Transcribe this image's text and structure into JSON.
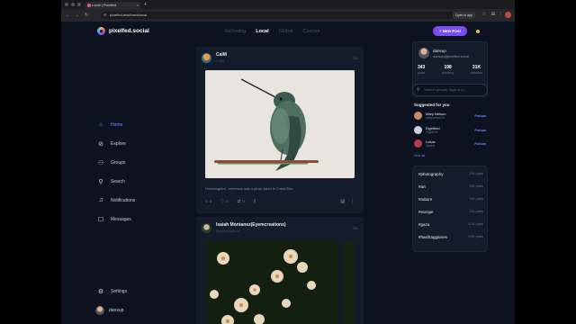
{
  "browser": {
    "tab_title": "Local | Pixelfed",
    "url": "pixelfed.test/i/web/local",
    "open_in_app": "Open in app"
  },
  "header": {
    "logo_text": "pixelfed.social",
    "nav": [
      "Following",
      "Local",
      "Global",
      "Custom"
    ],
    "new_post": "+ New Post"
  },
  "sidebar": {
    "items": [
      {
        "label": "Home",
        "icon": "home-icon"
      },
      {
        "label": "Explore",
        "icon": "compass-icon"
      },
      {
        "label": "Groups",
        "icon": "groups-icon"
      },
      {
        "label": "Search",
        "icon": "search-icon"
      },
      {
        "label": "Notifications",
        "icon": "bell-icon"
      },
      {
        "label": "Messages",
        "icon": "chat-icon"
      }
    ],
    "settings": "Settings",
    "user": "dansup"
  },
  "feed": {
    "posts": [
      {
        "name": "CalM",
        "handle": "CalM",
        "time": "18s",
        "caption": "Hummingbird - reference was a photo taken in Costa Rica",
        "likes": "0",
        "comments": "0",
        "shares": "0"
      },
      {
        "name": "Isaiah Montanez(Eyemcreations)",
        "handle": "Eyemcreations",
        "time": "35s"
      }
    ]
  },
  "profile": {
    "username": "dansup",
    "email": "dansup@pixelfed.social",
    "stats": [
      {
        "value": "343",
        "label": "posts"
      },
      {
        "value": "198",
        "label": "following"
      },
      {
        "value": "31K",
        "label": "followers"
      }
    ]
  },
  "search": {
    "placeholder": "Search people, tags or pl..."
  },
  "suggestions": {
    "title": "Suggested for you",
    "items": [
      {
        "name": "Mary Nelson",
        "handle": "marynelson18",
        "follow": "Follow"
      },
      {
        "name": "Elgirlbird",
        "handle": "Elgirlbird",
        "follow": "Follow"
      },
      {
        "name": "Lukas",
        "handle": "lukasw",
        "follow": "Follow"
      }
    ],
    "see_all": "See all"
  },
  "trending": [
    {
      "tag": "#photography",
      "count": "29K posts"
    },
    {
      "tag": "#art",
      "count": "19K posts"
    },
    {
      "tag": "#nature",
      "count": "13K posts"
    },
    {
      "tag": "#europe",
      "count": "12K posts"
    },
    {
      "tag": "#gaza",
      "count": "8.1K posts"
    },
    {
      "tag": "#hashtaggames",
      "count": "5.9K posts"
    }
  ],
  "colors": {
    "accent": "#7b4cf0",
    "link": "#6f8cff",
    "bg": "#0c1220",
    "card": "#141b2b"
  }
}
